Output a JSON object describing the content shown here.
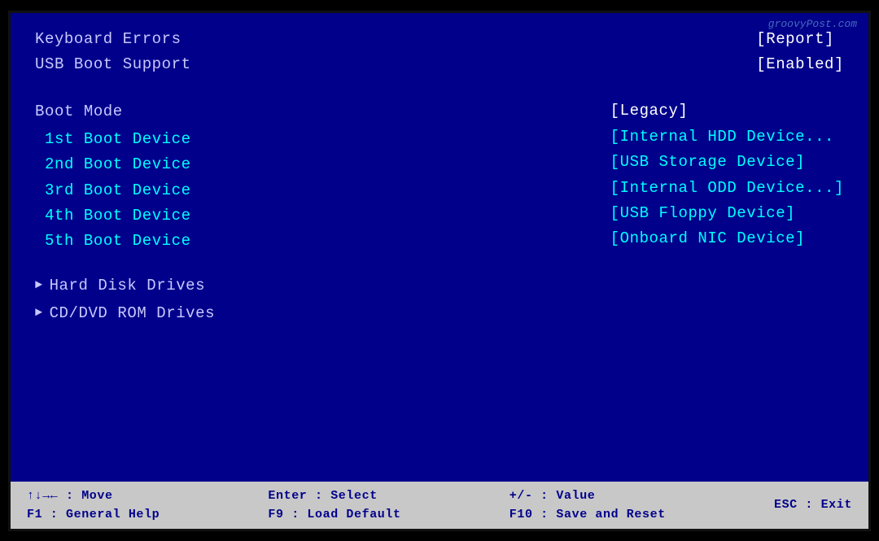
{
  "watermark": "groovyPost.com",
  "top_items": [
    {
      "label": "Keyboard Errors",
      "value": "[Report]"
    },
    {
      "label": "USB Boot Support",
      "value": "[Enabled]"
    }
  ],
  "boot_mode": {
    "label": "Boot Mode",
    "value": "[Legacy]"
  },
  "boot_devices": [
    {
      "label": "1st Boot Device",
      "value": "[Internal HDD Device..."
    },
    {
      "label": "2nd Boot Device",
      "value": "[USB Storage Device]"
    },
    {
      "label": "3rd Boot Device",
      "value": "[Internal ODD Device...]"
    },
    {
      "label": "4th Boot Device",
      "value": "[USB Floppy Device]"
    },
    {
      "label": "5th Boot Device",
      "value": "[Onboard NIC Device]"
    }
  ],
  "submenus": [
    "Hard Disk Drives",
    "CD/DVD ROM Drives"
  ],
  "footer": {
    "col1_line1": "↑↓→← : Move",
    "col1_line2": "F1 : General Help",
    "col2_line1": "Enter : Select",
    "col2_line2": "F9 : Load Default",
    "col3_line1": "+/- : Value",
    "col3_line2": "F10 : Save and Reset",
    "col4_line1": "ESC : Exit",
    "col4_line2": ""
  }
}
